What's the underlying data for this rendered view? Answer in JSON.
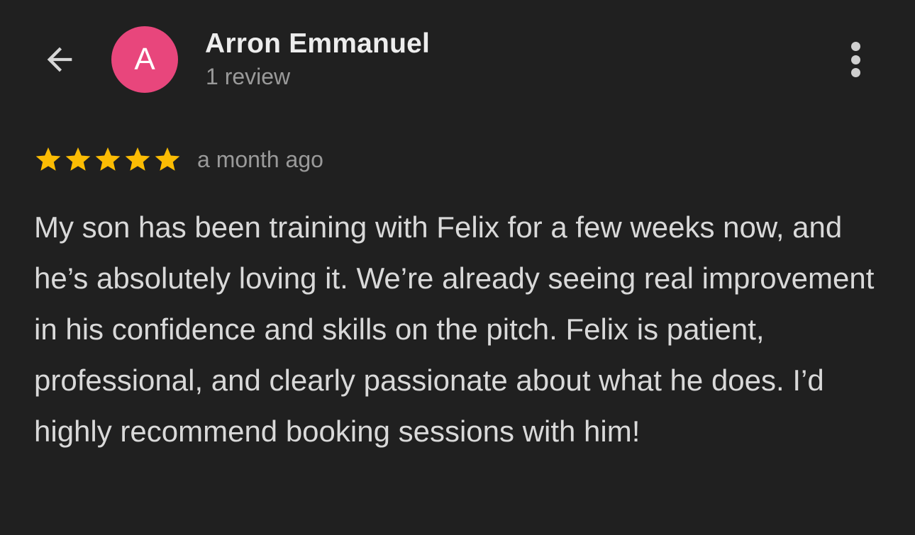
{
  "header": {
    "back_icon": "arrow-left-icon",
    "avatar_letter": "A",
    "avatar_color": "#e8467c",
    "reviewer_name": "Arron Emmanuel",
    "review_count": "1 review",
    "more_icon": "more-vertical-icon"
  },
  "review": {
    "rating": 5,
    "rating_max": 5,
    "star_color": "#fbbc04",
    "date": "a month ago",
    "text": "My son has been training with Felix for a few weeks now, and he’s absolutely loving it. We’re already seeing real improvement in his confidence and skills on the pitch. Felix is patient, professional, and clearly passionate about what he does. I’d highly recommend booking sessions with him!"
  }
}
